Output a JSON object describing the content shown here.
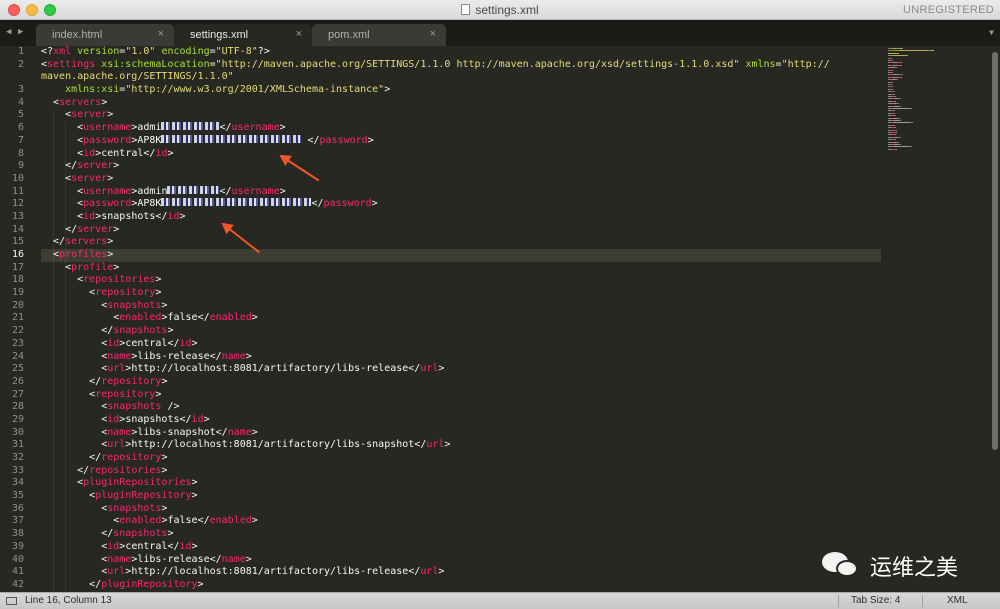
{
  "window": {
    "title": "settings.xml",
    "registration": "UNREGISTERED"
  },
  "tabs": [
    {
      "label": "index.html",
      "close": "×",
      "active": false
    },
    {
      "label": "settings.xml",
      "close": "×",
      "active": true
    },
    {
      "label": "pom.xml",
      "close": "×",
      "active": false
    }
  ],
  "tab_nav": {
    "prev": "◀",
    "next": "▶",
    "menu": "▼"
  },
  "editor": {
    "current_line": 16,
    "line_numbers": [
      "1",
      "2",
      "",
      "3",
      "4",
      "5",
      "6",
      "7",
      "8",
      "9",
      "10",
      "11",
      "12",
      "13",
      "14",
      "15",
      "16",
      "17",
      "18",
      "19",
      "20",
      "21",
      "22",
      "23",
      "24",
      "25",
      "26",
      "27",
      "28",
      "29",
      "30",
      "31",
      "32",
      "33",
      "34",
      "35",
      "36",
      "37",
      "38",
      "39",
      "40",
      "41",
      "42"
    ],
    "lines": [
      [
        [
          "p",
          "<?"
        ],
        [
          "tg",
          "xml"
        ],
        [
          "at",
          " version"
        ],
        [
          "p",
          "="
        ],
        [
          "sv",
          "\"1.0\""
        ],
        [
          "at",
          " encoding"
        ],
        [
          "p",
          "="
        ],
        [
          "sv",
          "\"UTF-8\""
        ],
        [
          "p",
          "?>"
        ]
      ],
      [
        [
          "p",
          "<"
        ],
        [
          "tg",
          "settings"
        ],
        [
          "at",
          " xsi:schemaLocation"
        ],
        [
          "p",
          "="
        ],
        [
          "sv",
          "\"http://maven.apache.org/SETTINGS/1.1.0 http://maven.apache.org/xsd/settings-1.1.0.xsd\""
        ],
        [
          "at",
          " xmlns"
        ],
        [
          "p",
          "="
        ],
        [
          "sv",
          "\"http://"
        ]
      ],
      [
        [
          "sv",
          "maven.apache.org/SETTINGS/1.1.0\""
        ]
      ],
      [
        [
          "p",
          "    "
        ],
        [
          "at",
          "xmlns:xsi"
        ],
        [
          "p",
          "="
        ],
        [
          "sv",
          "\"http://www.w3.org/2001/XMLSchema-instance\""
        ],
        [
          "p",
          ">"
        ]
      ],
      [
        [
          "p",
          "  <"
        ],
        [
          "tg",
          "servers"
        ],
        [
          "p",
          ">"
        ]
      ],
      [
        [
          "p",
          "    <"
        ],
        [
          "tg",
          "server"
        ],
        [
          "p",
          ">"
        ]
      ],
      [
        [
          "p",
          "      <"
        ],
        [
          "tg",
          "username"
        ],
        [
          "p",
          ">"
        ],
        [
          "cx",
          "admi"
        ],
        [
          "blur",
          ""
        ],
        [
          "p",
          "</"
        ],
        [
          "tg",
          "username"
        ],
        [
          "p",
          ">"
        ]
      ],
      [
        [
          "p",
          "      <"
        ],
        [
          "tg",
          "password"
        ],
        [
          "p",
          ">"
        ],
        [
          "cx",
          "AP8K"
        ],
        [
          "blur",
          ""
        ],
        [
          "p",
          " </"
        ],
        [
          "tg",
          "password"
        ],
        [
          "p",
          ">"
        ]
      ],
      [
        [
          "p",
          "      <"
        ],
        [
          "tg",
          "id"
        ],
        [
          "p",
          ">"
        ],
        [
          "cx",
          "central"
        ],
        [
          "p",
          "</"
        ],
        [
          "tg",
          "id"
        ],
        [
          "p",
          ">"
        ]
      ],
      [
        [
          "p",
          "    </"
        ],
        [
          "tg",
          "server"
        ],
        [
          "p",
          ">"
        ]
      ],
      [
        [
          "p",
          "    <"
        ],
        [
          "tg",
          "server"
        ],
        [
          "p",
          ">"
        ]
      ],
      [
        [
          "p",
          "      <"
        ],
        [
          "tg",
          "username"
        ],
        [
          "p",
          ">"
        ],
        [
          "cx",
          "admin"
        ],
        [
          "blur",
          ""
        ],
        [
          "p",
          "</"
        ],
        [
          "tg",
          "username"
        ],
        [
          "p",
          ">"
        ]
      ],
      [
        [
          "p",
          "      <"
        ],
        [
          "tg",
          "password"
        ],
        [
          "p",
          ">"
        ],
        [
          "cx",
          "AP8K"
        ],
        [
          "blur",
          ""
        ],
        [
          "p",
          "</"
        ],
        [
          "tg",
          "password"
        ],
        [
          "p",
          ">"
        ]
      ],
      [
        [
          "p",
          "      <"
        ],
        [
          "tg",
          "id"
        ],
        [
          "p",
          ">"
        ],
        [
          "cx",
          "snapshots"
        ],
        [
          "p",
          "</"
        ],
        [
          "tg",
          "id"
        ],
        [
          "p",
          ">"
        ]
      ],
      [
        [
          "p",
          "    </"
        ],
        [
          "tg",
          "server"
        ],
        [
          "p",
          ">"
        ]
      ],
      [
        [
          "p",
          "  </"
        ],
        [
          "tg",
          "servers"
        ],
        [
          "p",
          ">"
        ]
      ],
      [
        [
          "p",
          "  <"
        ],
        [
          "tg",
          "profiles"
        ],
        [
          "p",
          ">"
        ]
      ],
      [
        [
          "p",
          "    <"
        ],
        [
          "tg",
          "profile"
        ],
        [
          "p",
          ">"
        ]
      ],
      [
        [
          "p",
          "      <"
        ],
        [
          "tg",
          "repositories"
        ],
        [
          "p",
          ">"
        ]
      ],
      [
        [
          "p",
          "        <"
        ],
        [
          "tg",
          "repository"
        ],
        [
          "p",
          ">"
        ]
      ],
      [
        [
          "p",
          "          <"
        ],
        [
          "tg",
          "snapshots"
        ],
        [
          "p",
          ">"
        ]
      ],
      [
        [
          "p",
          "            <"
        ],
        [
          "tg",
          "enabled"
        ],
        [
          "p",
          ">"
        ],
        [
          "cx",
          "false"
        ],
        [
          "p",
          "</"
        ],
        [
          "tg",
          "enabled"
        ],
        [
          "p",
          ">"
        ]
      ],
      [
        [
          "p",
          "          </"
        ],
        [
          "tg",
          "snapshots"
        ],
        [
          "p",
          ">"
        ]
      ],
      [
        [
          "p",
          "          <"
        ],
        [
          "tg",
          "id"
        ],
        [
          "p",
          ">"
        ],
        [
          "cx",
          "central"
        ],
        [
          "p",
          "</"
        ],
        [
          "tg",
          "id"
        ],
        [
          "p",
          ">"
        ]
      ],
      [
        [
          "p",
          "          <"
        ],
        [
          "tg",
          "name"
        ],
        [
          "p",
          ">"
        ],
        [
          "cx",
          "libs-release"
        ],
        [
          "p",
          "</"
        ],
        [
          "tg",
          "name"
        ],
        [
          "p",
          ">"
        ]
      ],
      [
        [
          "p",
          "          <"
        ],
        [
          "tg",
          "url"
        ],
        [
          "p",
          ">"
        ],
        [
          "cx",
          "http://localhost:8081/artifactory/libs-release"
        ],
        [
          "p",
          "</"
        ],
        [
          "tg",
          "url"
        ],
        [
          "p",
          ">"
        ]
      ],
      [
        [
          "p",
          "        </"
        ],
        [
          "tg",
          "repository"
        ],
        [
          "p",
          ">"
        ]
      ],
      [
        [
          "p",
          "        <"
        ],
        [
          "tg",
          "repository"
        ],
        [
          "p",
          ">"
        ]
      ],
      [
        [
          "p",
          "          <"
        ],
        [
          "tg",
          "snapshots"
        ],
        [
          "p",
          " />"
        ]
      ],
      [
        [
          "p",
          "          <"
        ],
        [
          "tg",
          "id"
        ],
        [
          "p",
          ">"
        ],
        [
          "cx",
          "snapshots"
        ],
        [
          "p",
          "</"
        ],
        [
          "tg",
          "id"
        ],
        [
          "p",
          ">"
        ]
      ],
      [
        [
          "p",
          "          <"
        ],
        [
          "tg",
          "name"
        ],
        [
          "p",
          ">"
        ],
        [
          "cx",
          "libs-snapshot"
        ],
        [
          "p",
          "</"
        ],
        [
          "tg",
          "name"
        ],
        [
          "p",
          ">"
        ]
      ],
      [
        [
          "p",
          "          <"
        ],
        [
          "tg",
          "url"
        ],
        [
          "p",
          ">"
        ],
        [
          "cx",
          "http://localhost:8081/artifactory/libs-snapshot"
        ],
        [
          "p",
          "</"
        ],
        [
          "tg",
          "url"
        ],
        [
          "p",
          ">"
        ]
      ],
      [
        [
          "p",
          "        </"
        ],
        [
          "tg",
          "repository"
        ],
        [
          "p",
          ">"
        ]
      ],
      [
        [
          "p",
          "      </"
        ],
        [
          "tg",
          "repositories"
        ],
        [
          "p",
          ">"
        ]
      ],
      [
        [
          "p",
          "      <"
        ],
        [
          "tg",
          "pluginRepositories"
        ],
        [
          "p",
          ">"
        ]
      ],
      [
        [
          "p",
          "        <"
        ],
        [
          "tg",
          "pluginRepository"
        ],
        [
          "p",
          ">"
        ]
      ],
      [
        [
          "p",
          "          <"
        ],
        [
          "tg",
          "snapshots"
        ],
        [
          "p",
          ">"
        ]
      ],
      [
        [
          "p",
          "            <"
        ],
        [
          "tg",
          "enabled"
        ],
        [
          "p",
          ">"
        ],
        [
          "cx",
          "false"
        ],
        [
          "p",
          "</"
        ],
        [
          "tg",
          "enabled"
        ],
        [
          "p",
          ">"
        ]
      ],
      [
        [
          "p",
          "          </"
        ],
        [
          "tg",
          "snapshots"
        ],
        [
          "p",
          ">"
        ]
      ],
      [
        [
          "p",
          "          <"
        ],
        [
          "tg",
          "id"
        ],
        [
          "p",
          ">"
        ],
        [
          "cx",
          "central"
        ],
        [
          "p",
          "</"
        ],
        [
          "tg",
          "id"
        ],
        [
          "p",
          ">"
        ]
      ],
      [
        [
          "p",
          "          <"
        ],
        [
          "tg",
          "name"
        ],
        [
          "p",
          ">"
        ],
        [
          "cx",
          "libs-release"
        ],
        [
          "p",
          "</"
        ],
        [
          "tg",
          "name"
        ],
        [
          "p",
          ">"
        ]
      ],
      [
        [
          "p",
          "          <"
        ],
        [
          "tg",
          "url"
        ],
        [
          "p",
          ">"
        ],
        [
          "cx",
          "http://localhost:8081/artifactory/libs-release"
        ],
        [
          "p",
          "</"
        ],
        [
          "tg",
          "url"
        ],
        [
          "p",
          ">"
        ]
      ],
      [
        [
          "p",
          "        </"
        ],
        [
          "tg",
          "pluginRepository"
        ],
        [
          "p",
          ">"
        ]
      ]
    ]
  },
  "watermark": {
    "text": "运维之美"
  },
  "statusbar": {
    "position": "Line 16, Column 13",
    "tab_size": "Tab Size: 4",
    "syntax": "XML"
  },
  "colors": {
    "background": "#272822",
    "tag": "#f92672",
    "attribute": "#a6e22e",
    "string": "#e6db74",
    "text": "#f8f8f2",
    "annotation_arrow": "#f0562a"
  }
}
